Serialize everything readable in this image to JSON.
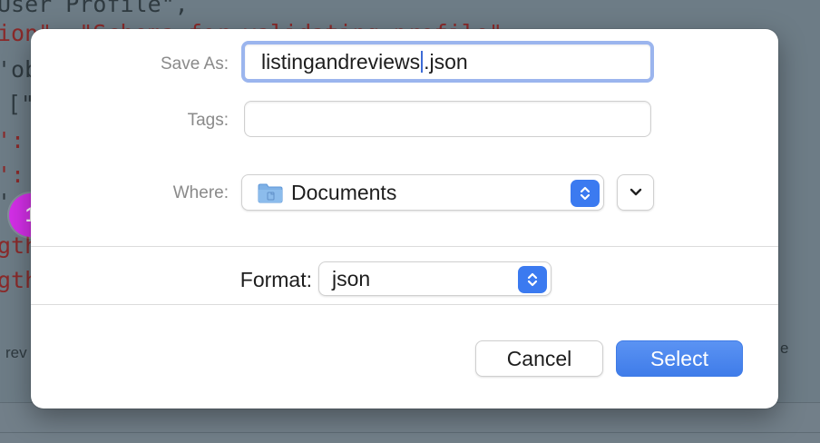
{
  "background": {
    "code_lines": [
      {
        "text": "User Profile\",",
        "red": false
      },
      {
        "text": "ion\": \"Schema for validating profile\",",
        "red": true
      },
      {
        "text": "'ob",
        "red": false
      },
      {
        "text": "[\"",
        "red": false
      },
      {
        "text": "':",
        "red": true
      },
      {
        "text": "':",
        "red": true
      },
      {
        "text": "'",
        "red": false
      },
      {
        "text": "gth",
        "red": true
      },
      {
        "text": "gth",
        "red": true
      }
    ],
    "left_fragment": "rev",
    "right_fragment": "e"
  },
  "dialog": {
    "save_as": {
      "label": "Save As:",
      "value_before_caret": "listingandreviews",
      "value_after_caret": ".json"
    },
    "tags": {
      "label": "Tags:",
      "value": ""
    },
    "where": {
      "label": "Where:",
      "value": "Documents",
      "icon": "folder-icon"
    },
    "format": {
      "label": "Format:",
      "value": "json"
    },
    "buttons": {
      "cancel": "Cancel",
      "select": "Select"
    }
  },
  "badge": {
    "number": "1",
    "color": "#d42fe8"
  },
  "colors": {
    "accent": "#3b7af0",
    "focus_ring": "#9bb5ee",
    "overlay": "#6d7c86"
  }
}
